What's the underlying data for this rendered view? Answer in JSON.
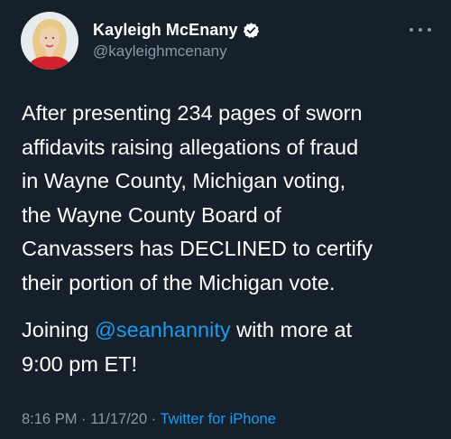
{
  "author": {
    "display_name": "Kayleigh McEnany",
    "handle": "@kayleighmcenany",
    "verified": true,
    "avatar": "profile-photo"
  },
  "tweet": {
    "lines_p1": [
      "After presenting 234 pages of sworn",
      "affidavits raising allegations of fraud",
      "in Wayne County, Michigan voting,",
      "the Wayne County Board of",
      "Canvassers has DECLINED to certify",
      "their portion of the Michigan vote."
    ],
    "p2_prefix": "Joining ",
    "p2_mention": "@seanhannity",
    "p2_suffix": " with more at",
    "p2_line2": "9:00 pm ET!"
  },
  "meta": {
    "time": "8:16 PM",
    "sep1": " · ",
    "date": "11/17/20",
    "sep2": " · ",
    "source": "Twitter for iPhone"
  },
  "icons": {
    "verified": "verified-badge-icon",
    "more": "more-options-icon"
  },
  "colors": {
    "background": "#15202b",
    "text": "#ffffff",
    "secondary": "#8899a6",
    "link": "#1d9bf0"
  }
}
